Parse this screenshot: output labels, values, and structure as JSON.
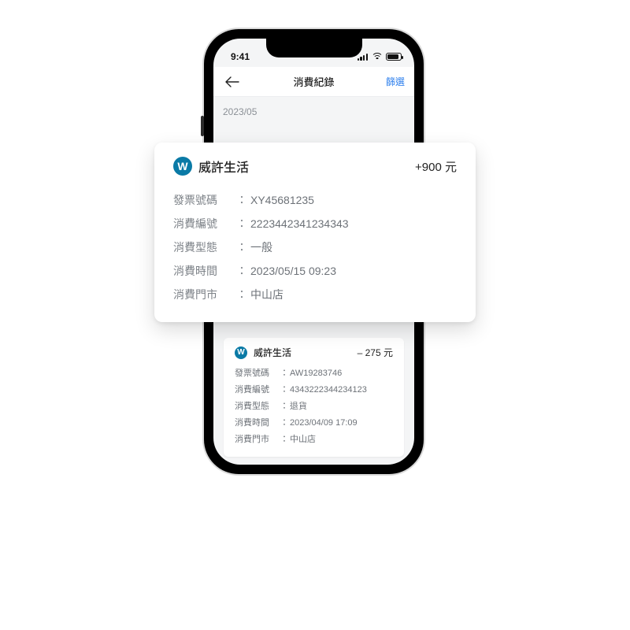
{
  "statusbar": {
    "time": "9:41"
  },
  "navbar": {
    "title": "消費紀錄",
    "action": "篩選"
  },
  "section": {
    "date": "2023/05"
  },
  "logo_glyph": "W",
  "fields": {
    "invoice": "發票號碼",
    "tx_id": "消費編號",
    "tx_type": "消費型態",
    "tx_time": "消費時間",
    "store": "消費門市",
    "colon": "："
  },
  "records": [
    {
      "brand": "威許生活",
      "amount": "+900 元",
      "invoice": "XY45681235",
      "tx_id": "2223442341234343",
      "tx_type": "一般",
      "tx_time": "2023/05/15 09:23",
      "store": "中山店"
    },
    {
      "brand": "威許生活",
      "amount": "– 275 元",
      "invoice": "AW19283746",
      "tx_id": "4343222344234123",
      "tx_type": "退貨",
      "tx_time": "2023/04/09 17:09",
      "store": "中山店"
    }
  ]
}
